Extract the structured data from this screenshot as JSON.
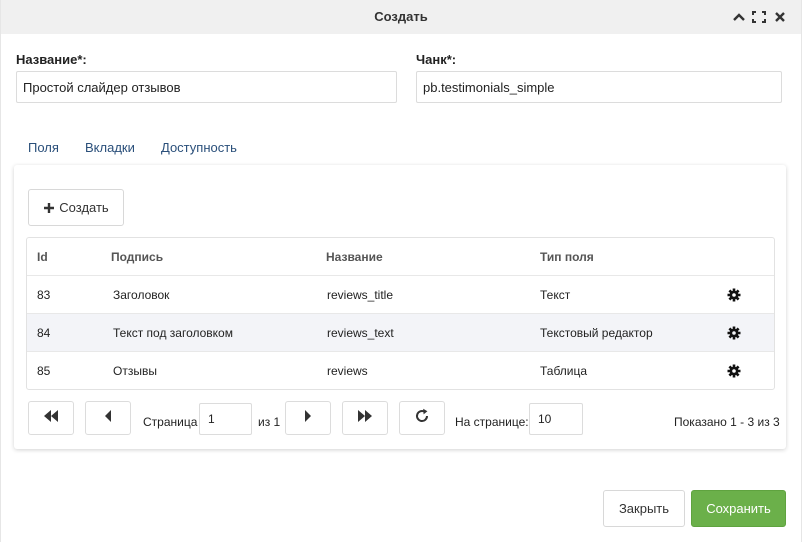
{
  "window": {
    "title": "Создать",
    "icons": [
      "chevron-up-icon",
      "expand-icon",
      "close-icon"
    ]
  },
  "form": {
    "name_label": "Название*:",
    "name_value": "Простой слайдер отзывов",
    "chunk_label": "Чанк*:",
    "chunk_value": "pb.testimonials_simple"
  },
  "tabs": [
    {
      "label": "Поля"
    },
    {
      "label": "Вкладки"
    },
    {
      "label": "Доступность"
    }
  ],
  "toolbar": {
    "create_label": "Создать",
    "create_icon": "plus-icon"
  },
  "grid": {
    "columns": [
      "Id",
      "Подпись",
      "Название",
      "Тип поля"
    ],
    "rows": [
      {
        "id": "83",
        "caption": "Заголовок",
        "name": "reviews_title",
        "type": "Текст"
      },
      {
        "id": "84",
        "caption": "Текст под заголовком",
        "name": "reviews_text",
        "type": "Текстовый редактор"
      },
      {
        "id": "85",
        "caption": "Отзывы",
        "name": "reviews",
        "type": "Таблица"
      }
    ],
    "row_action_icon": "gear-icon"
  },
  "pagination": {
    "page_label": "Страница",
    "page_value": "1",
    "of_label": "из 1",
    "per_page_label": "На странице:",
    "per_page_value": "10",
    "summary": "Показано 1 - 3 из 3"
  },
  "footer": {
    "close_label": "Закрыть",
    "save_label": "Сохранить"
  },
  "colors": {
    "titlebar": "#f0f0f0",
    "tab_text": "#2a4f7a",
    "save_button": "#6bb04a",
    "alt_row": "#f3f4f8"
  }
}
